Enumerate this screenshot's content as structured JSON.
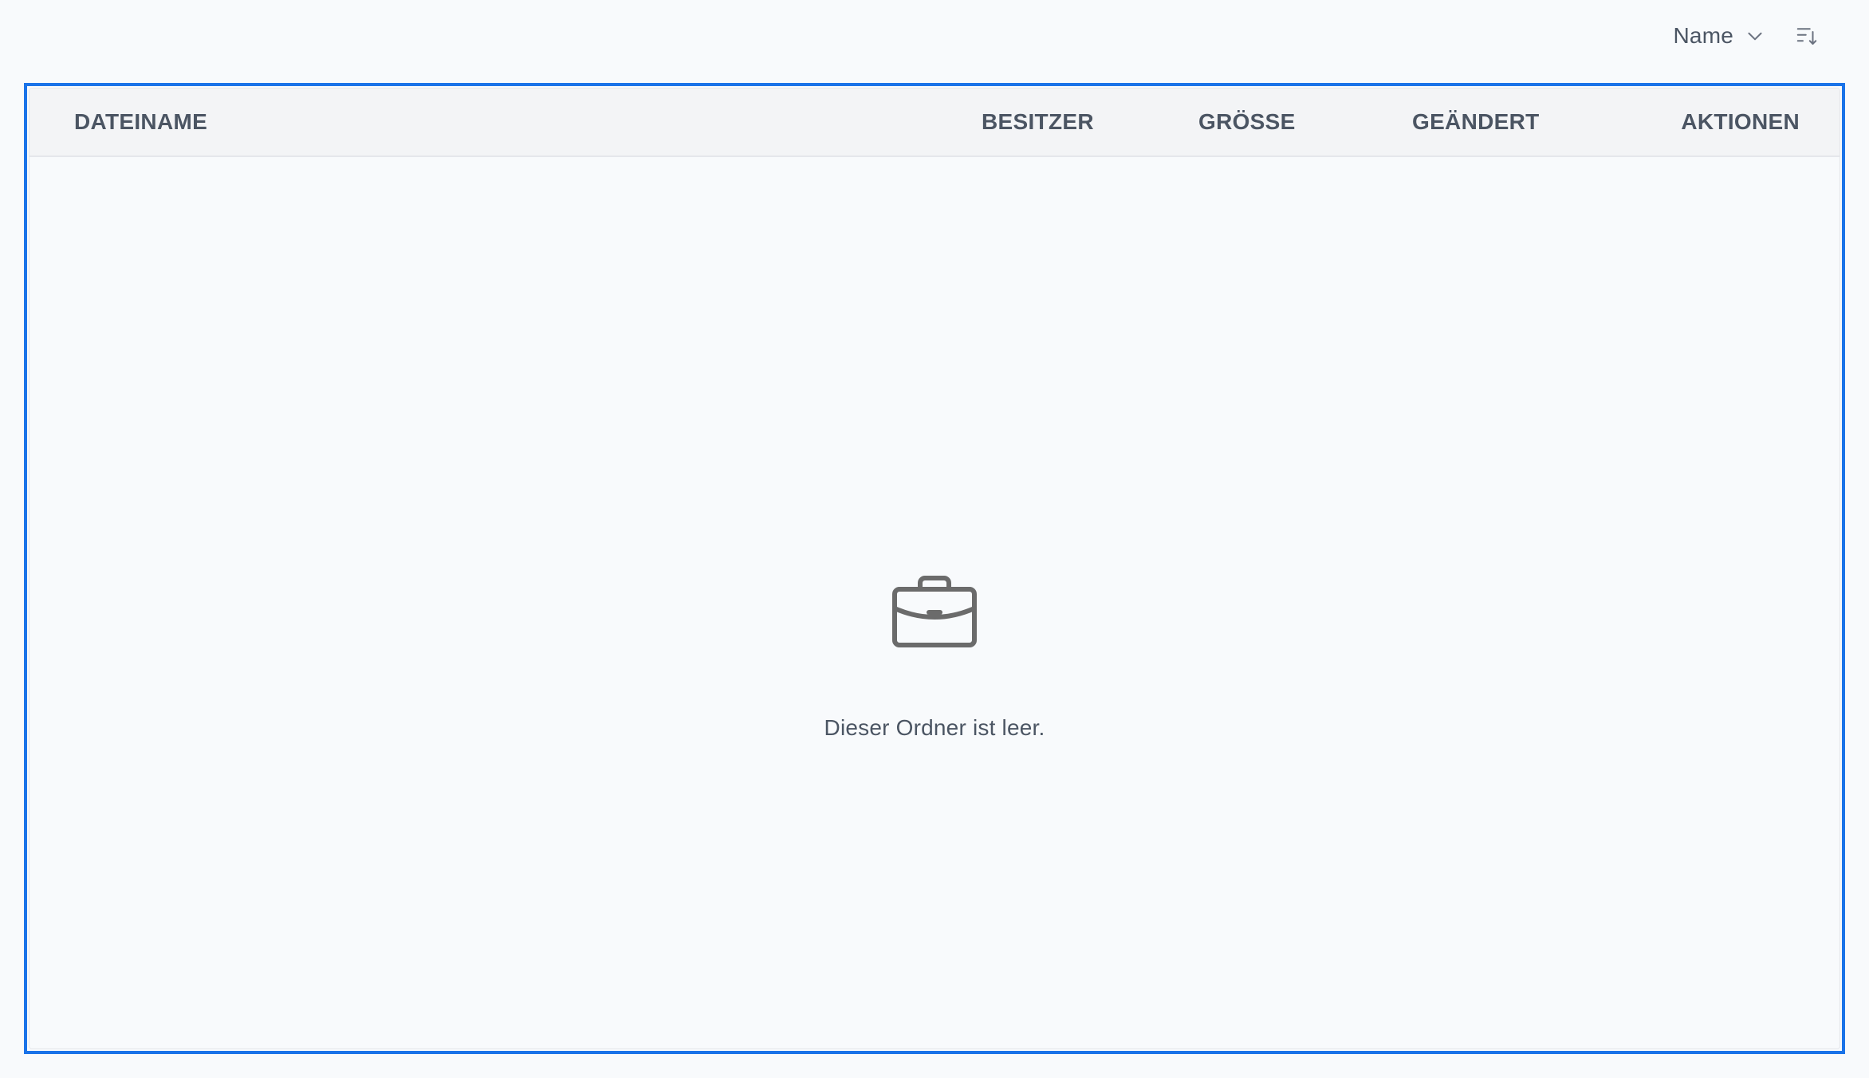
{
  "toolbar": {
    "sort_label": "Name",
    "icons": {
      "sort_dropdown": "chevron-down-icon",
      "sort_direction": "sort-descending-icon"
    }
  },
  "table": {
    "columns": [
      {
        "key": "name",
        "label": "DATEINAME"
      },
      {
        "key": "owner",
        "label": "BESITZER"
      },
      {
        "key": "size",
        "label": "GRÖSSE"
      },
      {
        "key": "modified",
        "label": "GEÄNDERT"
      },
      {
        "key": "actions",
        "label": "AKTIONEN"
      }
    ],
    "rows": []
  },
  "empty_state": {
    "icon": "briefcase-icon",
    "message": "Dieser Ordner ist leer."
  },
  "colors": {
    "focus_border": "#1a73e8",
    "header_bg": "#f3f4f6",
    "page_bg": "#f8fafc",
    "icon": "#6b6b6b"
  }
}
